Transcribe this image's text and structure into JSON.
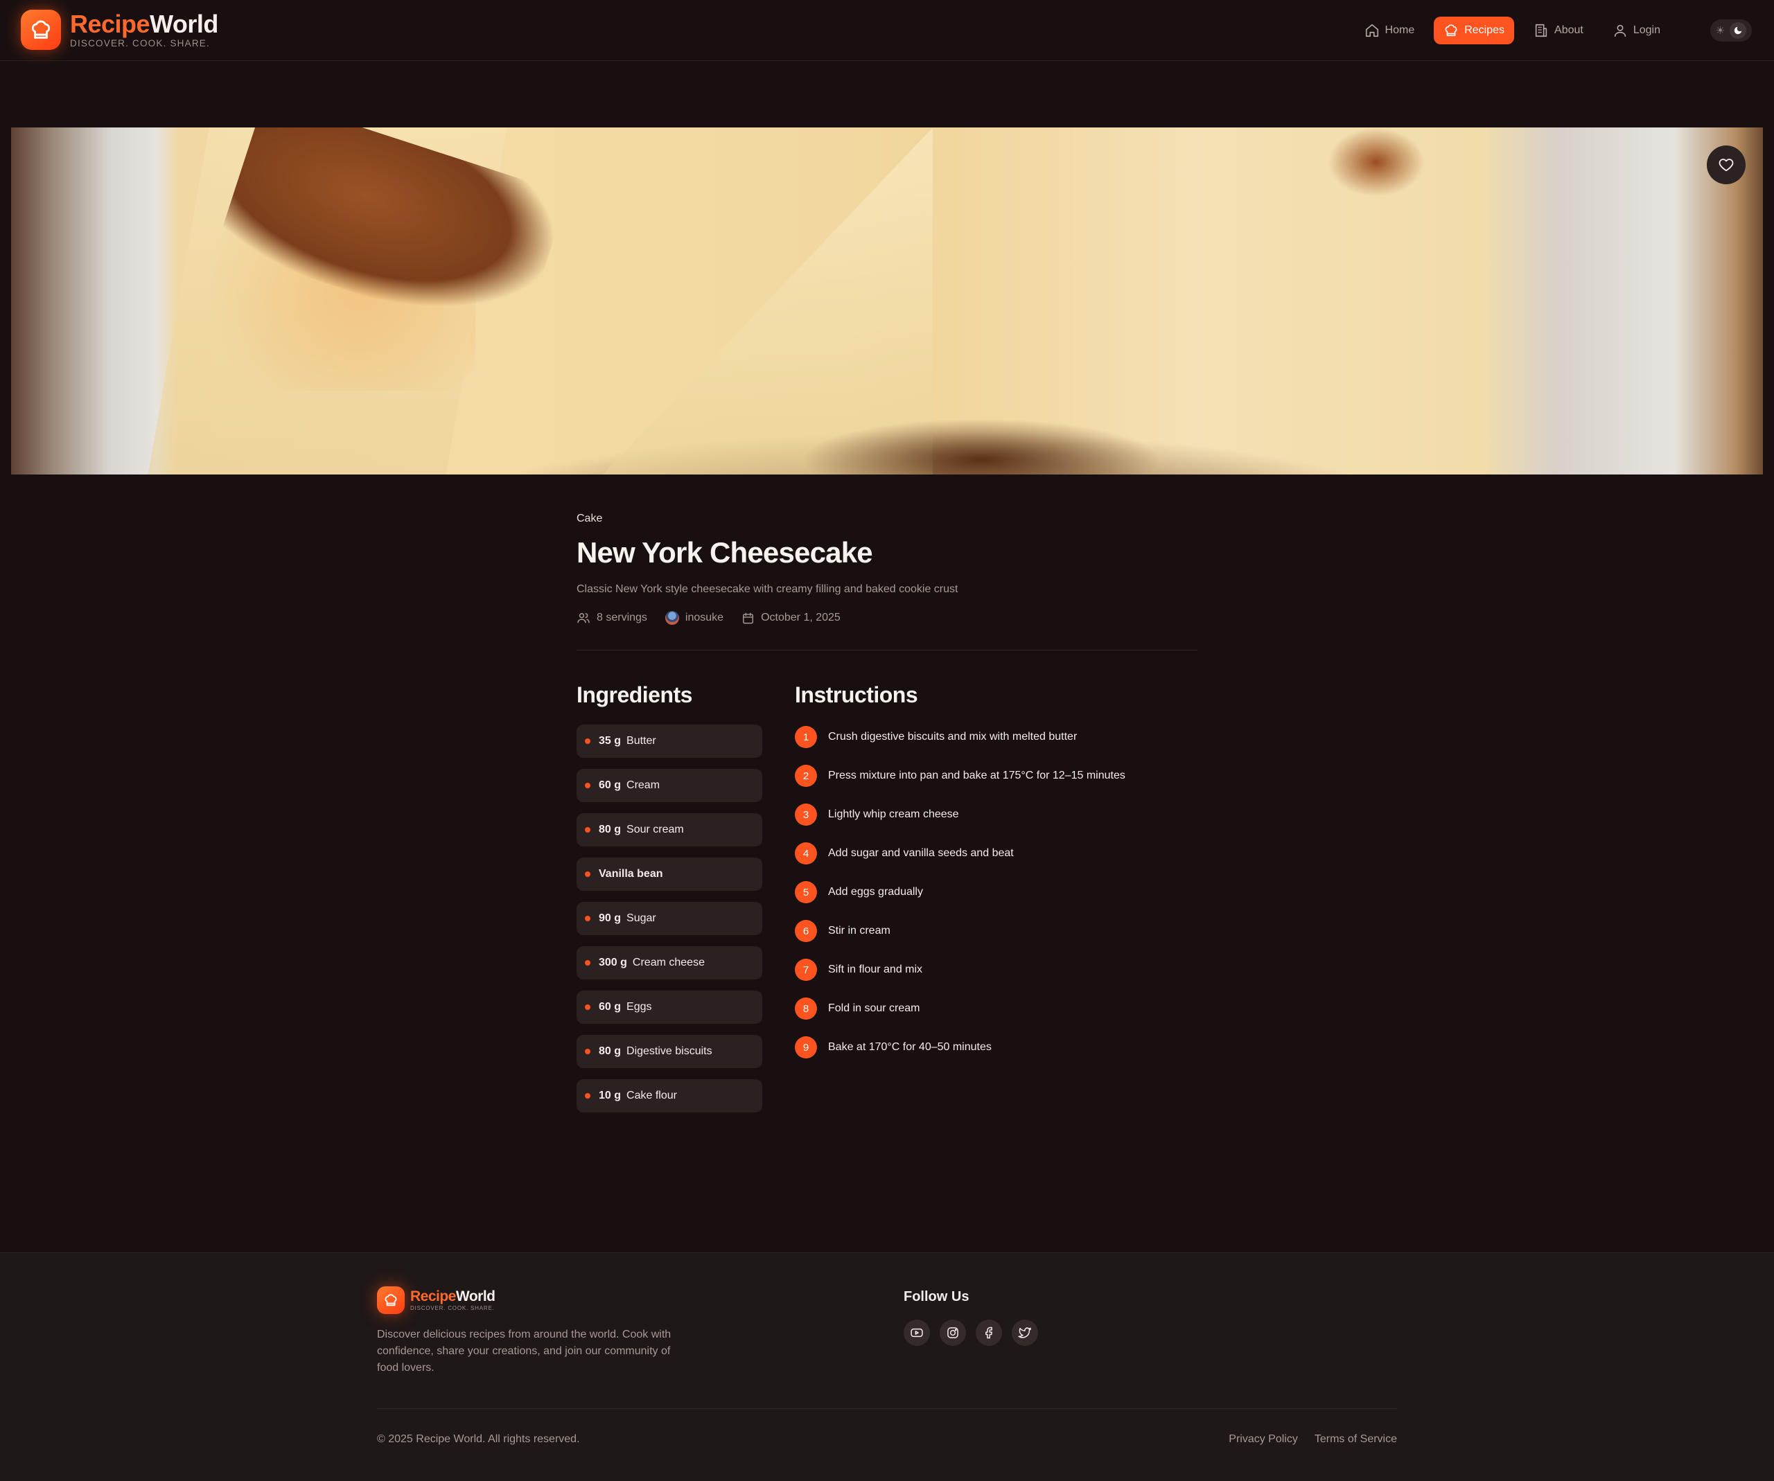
{
  "brand": {
    "name_part1": "Recipe",
    "name_part2": "World",
    "tagline": "DISCOVER. COOK. SHARE.",
    "accent_color": "#ff5420"
  },
  "nav": {
    "items": [
      {
        "label": "Home",
        "icon": "home-icon",
        "active": false
      },
      {
        "label": "Recipes",
        "icon": "chef-hat-icon",
        "active": true
      },
      {
        "label": "About",
        "icon": "building-icon",
        "active": false
      },
      {
        "label": "Login",
        "icon": "user-icon",
        "active": false
      }
    ],
    "theme": {
      "light_icon": "sun-icon",
      "dark_icon": "moon-icon",
      "selected": "dark"
    }
  },
  "hero": {
    "image_subject": "cheesecake-photo",
    "favorite_icon": "heart-icon"
  },
  "recipe": {
    "category": "Cake",
    "title": "New York Cheesecake",
    "description": "Classic New York style cheesecake with creamy filling and baked cookie crust",
    "servings": "8 servings",
    "author": "inosuke",
    "date": "October 1, 2025"
  },
  "ingredients": {
    "heading": "Ingredients",
    "items": [
      {
        "qty": "35 g",
        "name": "Butter"
      },
      {
        "qty": "60 g",
        "name": "Cream"
      },
      {
        "qty": "80 g",
        "name": "Sour cream"
      },
      {
        "qty": "",
        "name": "Vanilla bean"
      },
      {
        "qty": "90 g",
        "name": "Sugar"
      },
      {
        "qty": "300 g",
        "name": "Cream cheese"
      },
      {
        "qty": "60 g",
        "name": "Eggs"
      },
      {
        "qty": "80 g",
        "name": "Digestive biscuits"
      },
      {
        "qty": "10 g",
        "name": "Cake flour"
      }
    ]
  },
  "instructions": {
    "heading": "Instructions",
    "steps": [
      {
        "num": "1",
        "text": "Crush digestive biscuits and mix with melted butter"
      },
      {
        "num": "2",
        "text": "Press mixture into pan and bake at 175°C for 12–15 minutes"
      },
      {
        "num": "3",
        "text": "Lightly whip cream cheese"
      },
      {
        "num": "4",
        "text": "Add sugar and vanilla seeds and beat"
      },
      {
        "num": "5",
        "text": "Add eggs gradually"
      },
      {
        "num": "6",
        "text": "Stir in cream"
      },
      {
        "num": "7",
        "text": "Sift in flour and mix"
      },
      {
        "num": "8",
        "text": "Fold in sour cream"
      },
      {
        "num": "9",
        "text": "Bake at 170°C for 40–50 minutes"
      }
    ]
  },
  "footer": {
    "description": "Discover delicious recipes from around the world. Cook with confidence, share your creations, and join our community of food lovers.",
    "follow_heading": "Follow Us",
    "socials": [
      "youtube-icon",
      "instagram-icon",
      "facebook-icon",
      "twitter-icon"
    ],
    "copyright": "© 2025 Recipe World. All rights reserved.",
    "links": [
      "Privacy Policy",
      "Terms of Service"
    ]
  }
}
